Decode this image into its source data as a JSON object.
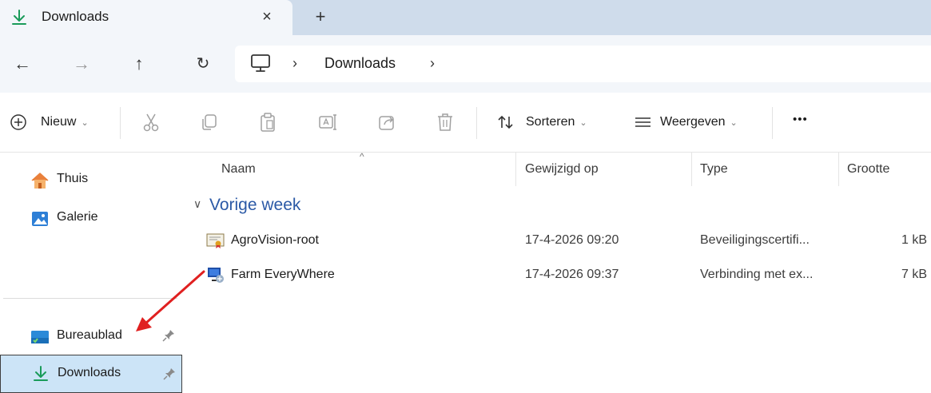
{
  "tab": {
    "title": "Downloads",
    "close_symbol": "×",
    "new_tab_symbol": "+",
    "icon": "download-icon"
  },
  "nav": {
    "back_symbol": "←",
    "forward_symbol": "→",
    "up_symbol": "↑",
    "refresh_symbol": "↻",
    "breadcrumb": {
      "root_icon": "this-pc-icon",
      "separator": "›",
      "folder": "Downloads"
    }
  },
  "toolbar": {
    "new_label": "Nieuw",
    "sort_label": "Sorteren",
    "view_label": "Weergeven",
    "more_symbol": "•••",
    "chevron": "⌄",
    "icons": [
      "plus-circle-icon",
      "cut-icon",
      "copy-icon",
      "paste-icon",
      "rename-icon",
      "share-icon",
      "delete-icon",
      "sort-icon",
      "view-icon"
    ]
  },
  "sidebar": {
    "items": [
      {
        "label": "Thuis",
        "icon": "home-icon"
      },
      {
        "label": "Galerie",
        "icon": "gallery-icon"
      },
      {
        "label": "Bureaublad",
        "icon": "desktop-icon",
        "pinned": true
      },
      {
        "label": "Downloads",
        "icon": "download-icon",
        "pinned": true,
        "selected": true
      }
    ]
  },
  "list": {
    "columns": [
      "Naam",
      "Gewijzigd op",
      "Type",
      "Grootte"
    ],
    "sort_caret": "^",
    "group": {
      "chevron": "∨",
      "title": "Vorige week"
    },
    "rows": [
      {
        "name": "AgroVision-root",
        "modified": "17-4-2026 09:20",
        "type": "Beveiligingscertifi...",
        "size": "1 kB",
        "icon": "certificate-icon"
      },
      {
        "name": "Farm EveryWhere",
        "modified": "17-4-2026 09:37",
        "type": "Verbinding met ex...",
        "size": "7 kB",
        "icon": "remote-desktop-icon"
      }
    ]
  },
  "colors": {
    "tabbar": "#cfdceb",
    "navbar": "#f3f6fa",
    "accent_green": "#1a9b5a",
    "group_title": "#2b59a6",
    "selected": "#cce4f7",
    "arrow": "#e02020"
  }
}
